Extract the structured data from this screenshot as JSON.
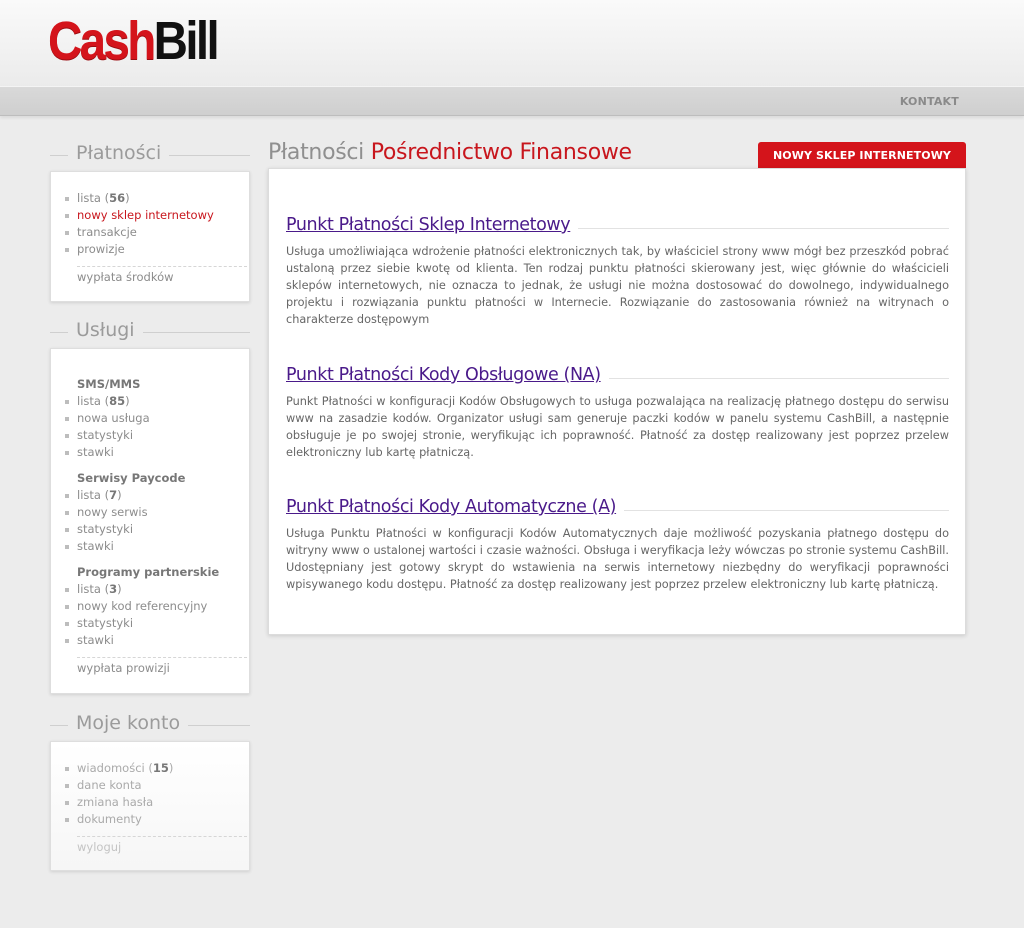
{
  "header": {
    "logo_part1": "Cash",
    "logo_part2": "Bill",
    "nav_contact": "KONTAKT"
  },
  "sidebar": {
    "payments": {
      "title": "Płatności",
      "items": [
        {
          "label": "lista",
          "count": "56"
        },
        {
          "label": "nowy sklep internetowy",
          "active": true
        },
        {
          "label": "transakcje"
        },
        {
          "label": "prowizje"
        }
      ],
      "footer_link": "wypłata środków"
    },
    "services": {
      "title": "Usługi",
      "groups": [
        {
          "title": "SMS/MMS",
          "items": [
            {
              "label": "lista",
              "count": "85"
            },
            {
              "label": "nowa usługa"
            },
            {
              "label": "statystyki"
            },
            {
              "label": "stawki"
            }
          ]
        },
        {
          "title": "Serwisy Paycode",
          "items": [
            {
              "label": "lista",
              "count": "7"
            },
            {
              "label": "nowy serwis"
            },
            {
              "label": "statystyki"
            },
            {
              "label": "stawki"
            }
          ]
        },
        {
          "title": "Programy partnerskie",
          "items": [
            {
              "label": "lista",
              "count": "3"
            },
            {
              "label": "nowy kod referencyjny"
            },
            {
              "label": "statystyki"
            },
            {
              "label": "stawki"
            }
          ]
        }
      ],
      "footer_link": "wypłata prowizji"
    },
    "account": {
      "title": "Moje konto",
      "items": [
        {
          "label": "wiadomości",
          "count": "15"
        },
        {
          "label": "dane konta"
        },
        {
          "label": "zmiana hasła"
        },
        {
          "label": "dokumenty"
        }
      ],
      "footer_link": "wyloguj"
    }
  },
  "main": {
    "title_part1": "Płatności",
    "title_part2": "Pośrednictwo Finansowe",
    "tab_badge": "NOWY SKLEP INTERNETOWY",
    "sections": [
      {
        "title": "Punkt Płatności Sklep Internetowy",
        "text": "Usługa umożliwiająca wdrożenie płatności elektronicznych tak, by właściciel strony www mógł bez przeszkód pobrać ustaloną przez siebie kwotę od klienta. Ten rodzaj punktu płatności skierowany jest, więc głównie do właścicieli sklepów internetowych, nie oznacza to jednak, że usługi nie można dostosować do dowolnego, indywidualnego projektu i rozwiązania punktu płatności w Internecie. Rozwiązanie do zastosowania również na witrynach o charakterze dostępowym"
      },
      {
        "title": "Punkt Płatności Kody Obsługowe (NA)",
        "text": "Punkt Płatności w konfiguracji Kodów Obsługowych to usługa pozwalająca na realizację płatnego dostępu do serwisu www na zasadzie kodów. Organizator usługi sam generuje paczki kodów w panelu systemu CashBill, a następnie obsługuje je po swojej stronie, weryfikując ich poprawność. Płatność za dostęp realizowany jest poprzez przelew elektroniczny lub kartę płatniczą."
      },
      {
        "title": "Punkt Płatności Kody Automatyczne (A)",
        "text": "Usługa Punktu Płatności w konfiguracji Kodów Automatycznych daje możliwość pozyskania płatnego dostępu do witryny www o ustalonej wartości i czasie ważności. Obsługa i weryfikacja leży wówczas po stronie systemu CashBill. Udostępniany jest gotowy skrypt do wstawienia na serwis internetowy niezbędny do weryfikacji poprawności wpisywanego kodu dostępu. Płatność za dostęp realizowany jest poprzez przelew elektroniczny lub kartę płatniczą."
      }
    ]
  }
}
